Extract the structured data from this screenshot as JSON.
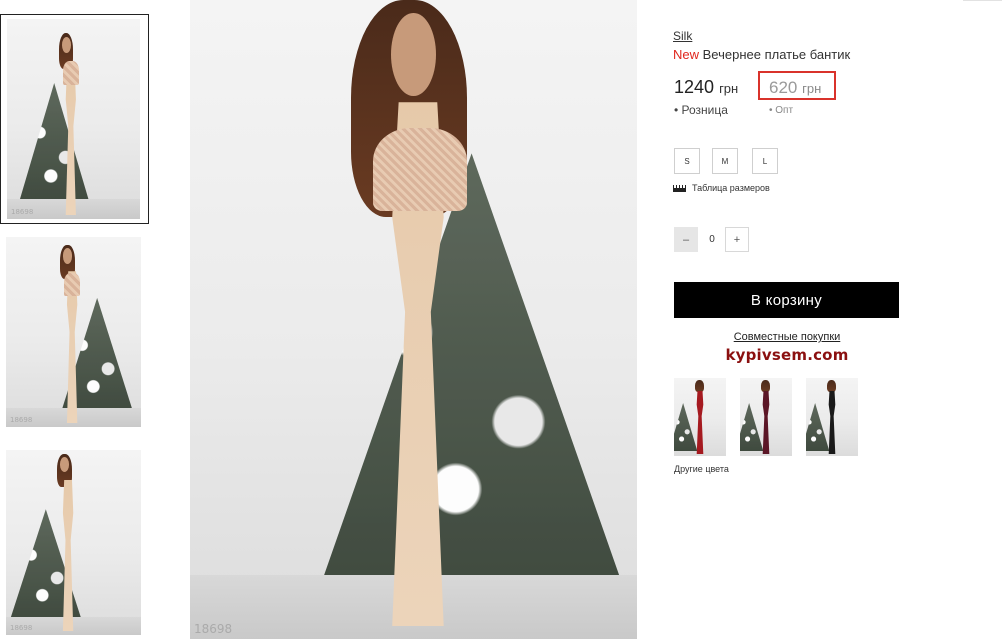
{
  "product": {
    "brand": "Silk",
    "new_badge": "New",
    "title": "Вечернее платье бантик",
    "retail_price": "1240",
    "retail_currency": "грн",
    "retail_label": "• Розница",
    "wholesale_price": "620",
    "wholesale_currency": "грн",
    "wholesale_label": "• Опт",
    "sizes": [
      "S",
      "M",
      "L"
    ],
    "size_table_label": "Таблица размеров",
    "quantity": "0",
    "qty_minus": "–",
    "qty_plus": "+",
    "add_to_cart": "В корзину",
    "joint_purchases_link": "Совместные покупки",
    "joint_purchases_logo": "kypivsem.com",
    "other_colors_label": "Другие цвета"
  },
  "gallery": {
    "thumbnail_codes": [
      "18698",
      "18698",
      "18698"
    ],
    "main_code": "18698"
  },
  "colors": {
    "accent_red": "#e0261d",
    "highlight_box": "#d9322b",
    "logo": "#8b1010",
    "cart_button": "#000000",
    "variants": [
      {
        "name": "red",
        "hex": "#a51a20"
      },
      {
        "name": "burgundy",
        "hex": "#5b1626"
      },
      {
        "name": "black",
        "hex": "#1a1a1a"
      }
    ],
    "dress_main": "#e8cdb0"
  }
}
